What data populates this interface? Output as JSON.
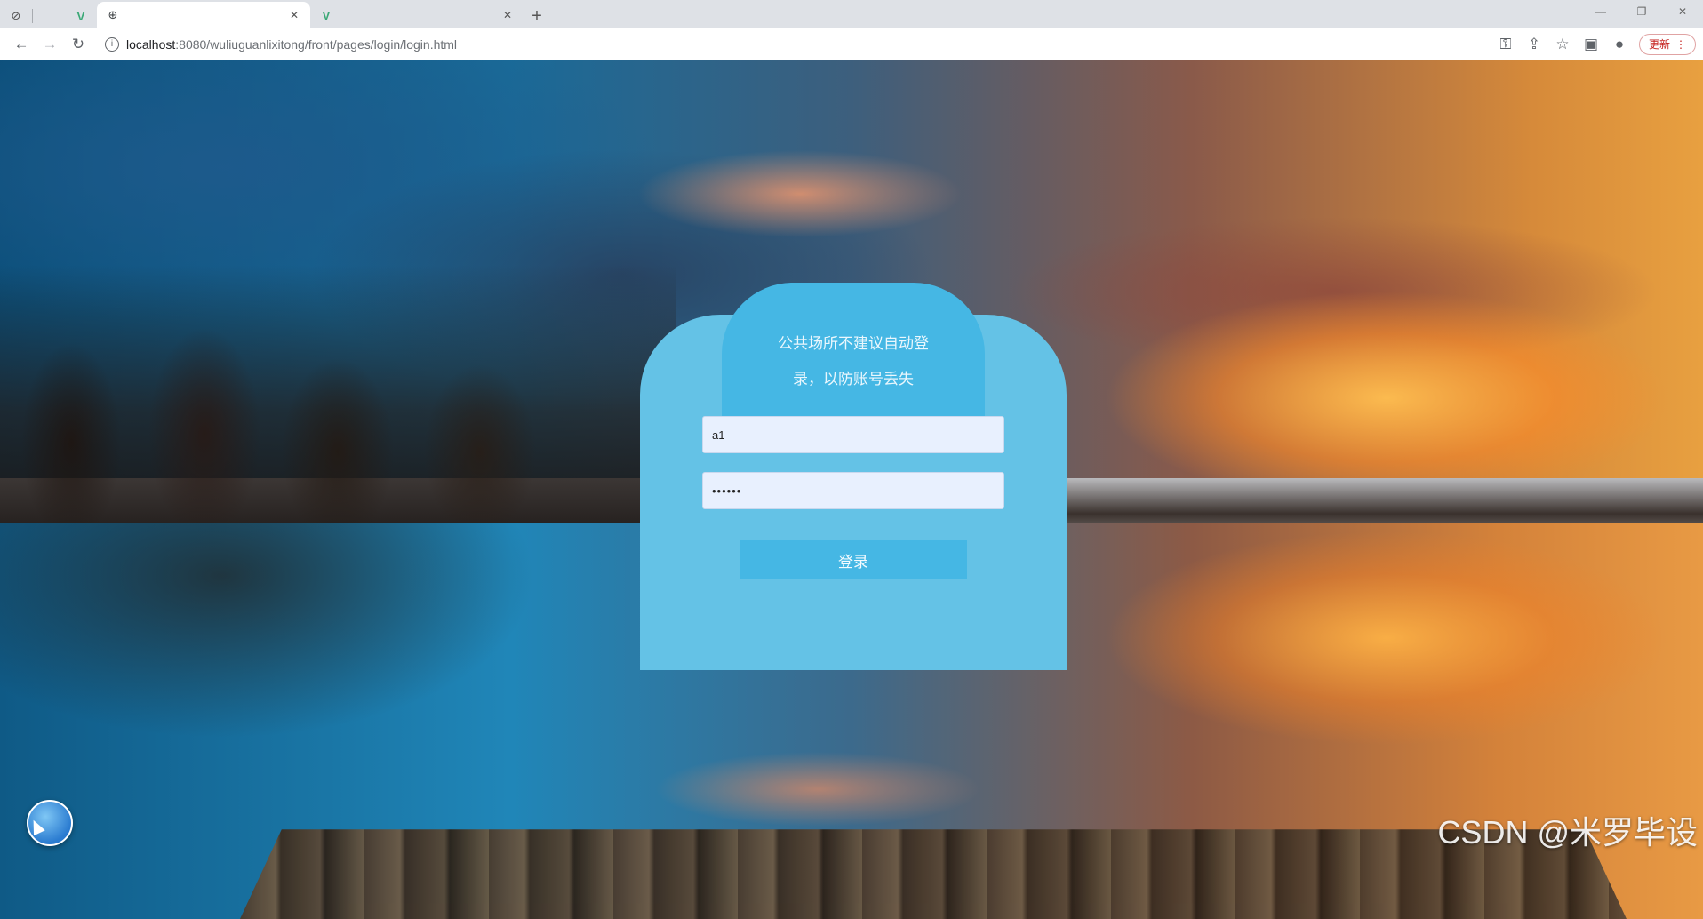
{
  "browser": {
    "tabs": [
      {
        "title": "",
        "icon": "globe-icon",
        "active": true
      },
      {
        "title": "",
        "icon": "vue-logo-icon",
        "active": false
      }
    ],
    "address_bar": {
      "url_host": "localhost",
      "url_rest": ":8080/wuliuguanlixitong/front/pages/login/login.html"
    },
    "update_label": "更新"
  },
  "login": {
    "notice": "公共场所不建议自动登录，以防账号丢失",
    "username_value": "a1",
    "password_value": "••••••",
    "submit_label": "登录",
    "card_color": "#64c2e6",
    "accent_color": "#45b7e4"
  },
  "watermark": "CSDN @米罗毕设"
}
